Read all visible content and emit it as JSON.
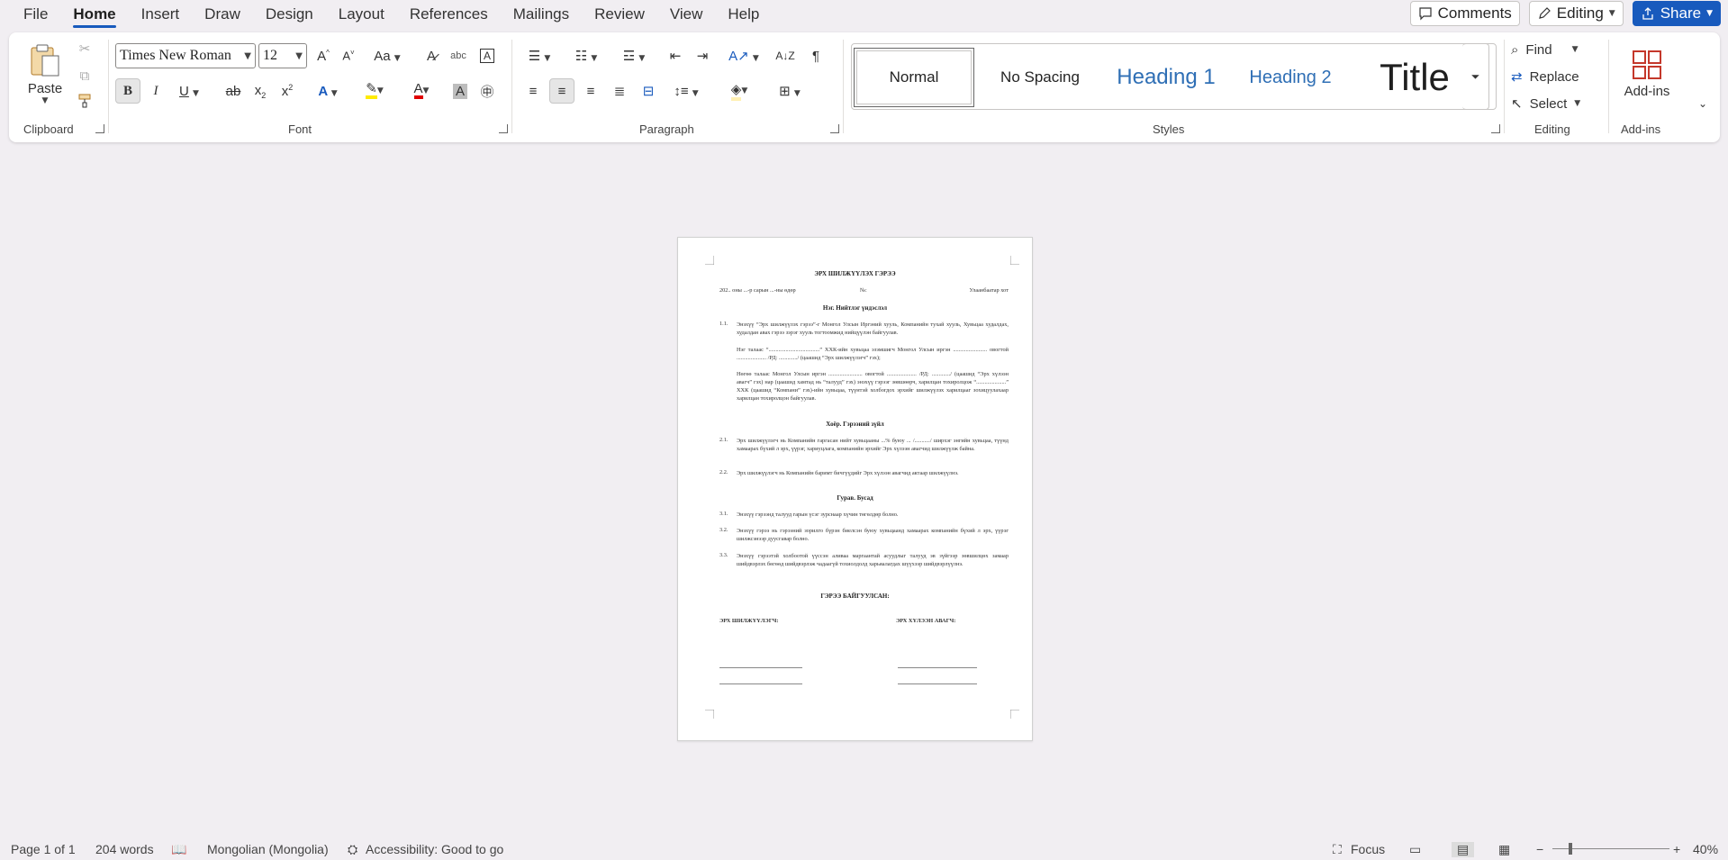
{
  "menu": {
    "tabs": [
      "File",
      "Home",
      "Insert",
      "Draw",
      "Design",
      "Layout",
      "References",
      "Mailings",
      "Review",
      "View",
      "Help"
    ],
    "active_tab": "Home",
    "comments_label": "Comments",
    "editing_label": "Editing",
    "share_label": "Share"
  },
  "ribbon": {
    "clipboard": {
      "paste_label": "Paste",
      "group_label": "Clipboard"
    },
    "font": {
      "font_name": "Times New Roman",
      "font_size": "12",
      "group_label": "Font"
    },
    "paragraph": {
      "group_label": "Paragraph"
    },
    "styles": {
      "items": [
        "Normal",
        "No Spacing",
        "Heading 1",
        "Heading 2",
        "Title"
      ],
      "selected": "Normal",
      "group_label": "Styles"
    },
    "editing": {
      "find_label": "Find",
      "replace_label": "Replace",
      "select_label": "Select",
      "group_label": "Editing"
    },
    "addins": {
      "button_label": "Add-ins",
      "group_label": "Add-ins"
    }
  },
  "document": {
    "title": "ЭРХ ШИЛЖҮҮЛЭХ ГЭРЭЭ",
    "date_line": "202.. оны ...-р сарын ...-ны өдөр",
    "number_label": "№:",
    "city": "Улаанбаатар хот",
    "section1_title": "Нэг. Нийтлэг үндэслэл",
    "p1_1_num": "1.1.",
    "p1_1": "Энэхүү “Эрх шилжүүлэх гэрээ”-г Монгол Улсын Иргэний хууль, Компанийн тухай хууль, Хувьцаа худалдах, худалдан авах гэрээ зэрэг хууль тогтоомжид нийцүүлэн байгуулав.",
    "p1_party1": "Нэг талаас “....................................” ХХК-ийн хувьцаа эзэмшигч Монгол Улсын иргэн ........................ овогтой ..................... /РД: ............./ (цаашид “Эрх шилжүүлэгч” гэх);",
    "p1_party2": "Нөгөө талаас Монгол Улсын иргэн ........................ овогтой ..................... /РД: ............./ (цаашид “Эрх хүлээн авагч” гэх) нар (цаашид хамтад нь “талууд” гэх) энэхүү гэрээг зөвшөөрч, харилцан тохиролцож “.....................” ХХК (цаашид “Компани” гэх)-ийн хувьцаа, түүнтэй холбогдох эрхийг шилжүүлэх харилцааг зохицуулахаар харилцан тохиролцон байгуулав.",
    "section2_title": "Хоёр. Гэрээний зүйл",
    "p2_1_num": "2.1.",
    "p2_1": "Эрх шилжүүлэгч нь Компанийн гаргасан нийт хувьцааны ...% буюу ... /.........../ ширхэг энгийн хувьцаа, түүнд хамаарах бүхий л эрх, үүрэг, хариуцлага, компанийн эрхийг Эрх хүлээн авагчид шилжүүлж байна.",
    "p2_2_num": "2.2.",
    "p2_2": "Эрх шилжүүлэгч нь Компанийн баримт бичгүүдийг Эрх хүлээн авагчид актаар шилжүүлнэ.",
    "section3_title": "Гурав. Бусад",
    "p3_1_num": "3.1.",
    "p3_1": "Энэхүү гэрээнд талууд гарын үсэг зурснаар хүчин төгөлдөр болно.",
    "p3_2_num": "3.2.",
    "p3_2": "Энэхүү гэрээ нь гэрээний зорилго бүрэн биелсэн буюу хувьцаанд хамаарах компанийн бүхий л эрх, үүрэг шилжсэнээр дуусгавар болно.",
    "p3_3_num": "3.3.",
    "p3_3": "Энэхүү гэрээтэй холбоотой үүссэн аливаа маргаантай асуудлыг талууд эв зүйгээр зөвшилцөх замаар шийдвэрлэх бөгөөд шийдвэрлэж чадаагүй тохиолдолд харьяалагдах шүүхээр шийдвэрлүүлнэ.",
    "signed_title": "ГЭРЭЭ БАЙГУУЛСАН:",
    "signer1": "ЭРХ ШИЛЖҮҮЛЭГЧ:",
    "signer2": "ЭРХ ХҮЛЭЭН АВАГЧ:"
  },
  "status": {
    "page": "Page 1 of 1",
    "words": "204 words",
    "language": "Mongolian (Mongolia)",
    "accessibility": "Accessibility: Good to go",
    "focus": "Focus",
    "zoom": "40%"
  }
}
